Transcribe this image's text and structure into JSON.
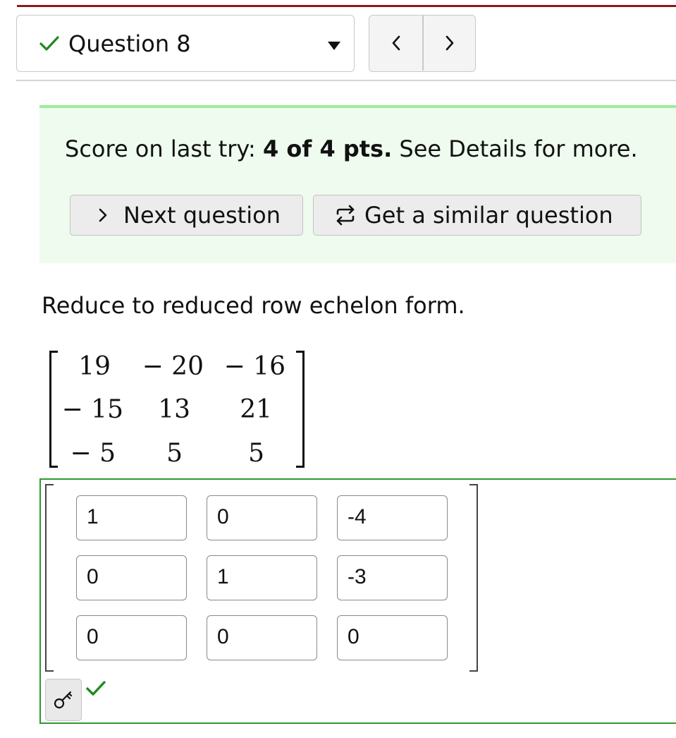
{
  "header": {
    "question_label": "Question 8",
    "status": "correct",
    "nav_prev_icon": "chevron-left-icon",
    "nav_next_icon": "chevron-right-icon"
  },
  "score_panel": {
    "prefix": "Score on last try: ",
    "score": "4 of 4 pts.",
    "suffix": " See Details for more.",
    "next_button_label": "Next question",
    "similar_button_label": "Get a similar question"
  },
  "question": {
    "prompt": "Reduce to reduced row echelon form.",
    "matrix": [
      [
        "19",
        "− 20",
        "− 16"
      ],
      [
        "− 15",
        "13",
        "21"
      ],
      [
        "− 5",
        "5",
        "5"
      ]
    ]
  },
  "answer": {
    "cells": [
      [
        "1",
        "0",
        "-4"
      ],
      [
        "0",
        "1",
        "-3"
      ],
      [
        "0",
        "0",
        "0"
      ]
    ],
    "key_icon": "key-icon",
    "result": "correct"
  },
  "colors": {
    "top_rule": "#8b1a1a",
    "success_green": "#1e8a1e",
    "panel_bg": "#eefbee",
    "panel_border": "#9ceb9c",
    "answer_border": "#2d9a2d"
  }
}
